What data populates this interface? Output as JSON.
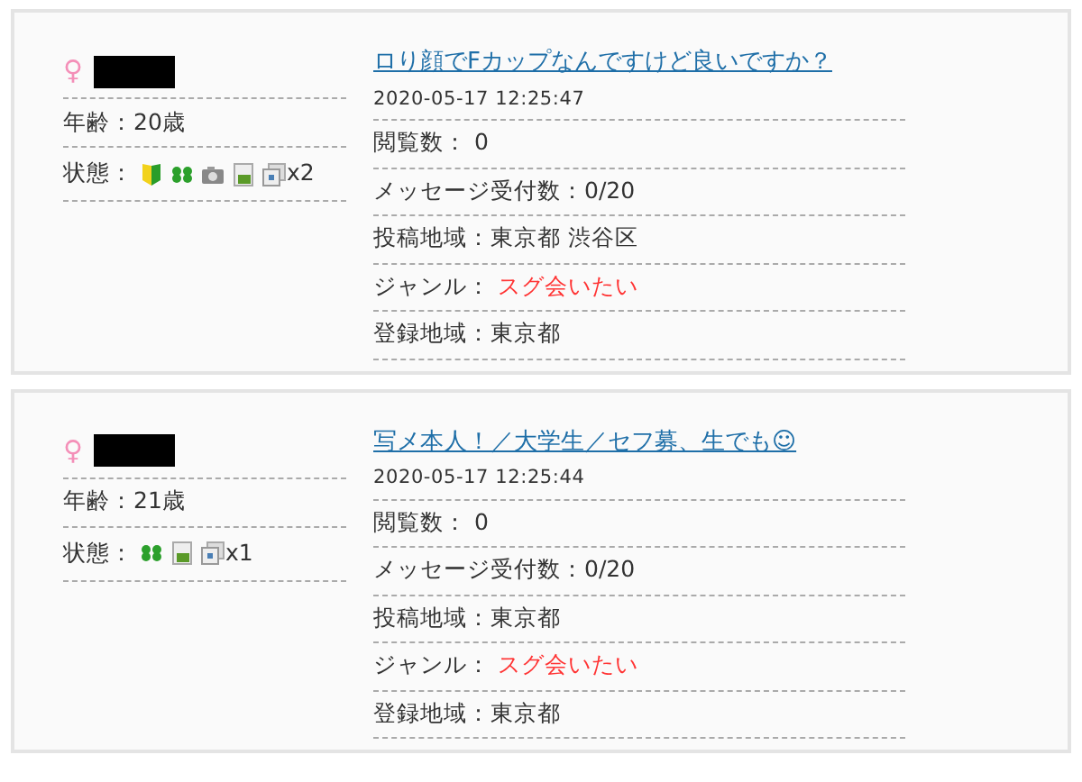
{
  "posts": [
    {
      "gender": "♀",
      "age": "年齢：20歳",
      "status_label": "状態：",
      "status_icons": [
        {
          "kind": "beginner"
        },
        {
          "kind": "clover"
        },
        {
          "kind": "camera"
        },
        {
          "kind": "photo"
        },
        {
          "kind": "album"
        }
      ],
      "photo_count": "x2",
      "title": "ロり顔でFカップなんですけど良いですか？",
      "date": "2020-05-17 12:25:47",
      "rows": [
        {
          "label": "閲覧数：",
          "value": " 0",
          "kind": "plain"
        },
        {
          "label": "メッセージ受付数：",
          "value": "0/20",
          "kind": "plain"
        },
        {
          "label": "投稿地域：",
          "value": "東京都 渋谷区",
          "kind": "plain"
        },
        {
          "label": "ジャンル：",
          "value": "スグ会いたい",
          "kind": "genre"
        },
        {
          "label": "登録地域：",
          "value": "東京都",
          "kind": "plain"
        }
      ]
    },
    {
      "gender": "♀",
      "age": "年齢：21歳",
      "status_label": "状態：",
      "status_icons": [
        {
          "kind": "clover"
        },
        {
          "kind": "photo"
        },
        {
          "kind": "album"
        }
      ],
      "photo_count": "x1",
      "title": "写メ本人！／大学生／セフ募、生でも☺",
      "date": "2020-05-17 12:25:44",
      "rows": [
        {
          "label": "閲覧数：",
          "value": " 0",
          "kind": "plain"
        },
        {
          "label": "メッセージ受付数：",
          "value": "0/20",
          "kind": "plain"
        },
        {
          "label": "投稿地域：",
          "value": "東京都",
          "kind": "plain"
        },
        {
          "label": "ジャンル：",
          "value": "スグ会いたい",
          "kind": "genre"
        },
        {
          "label": "登録地域：",
          "value": "東京都",
          "kind": "plain"
        }
      ]
    }
  ]
}
